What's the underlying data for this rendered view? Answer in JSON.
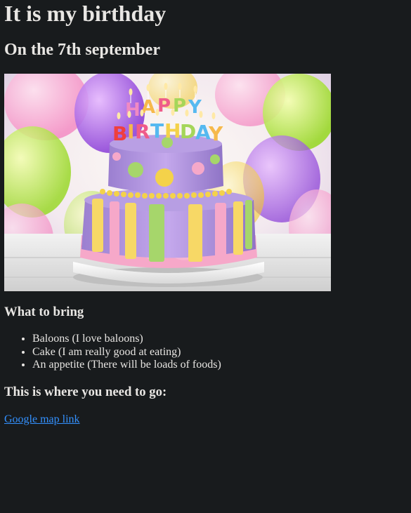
{
  "page": {
    "title": "It is my birthday",
    "subtitle": "On the 7th september",
    "image": {
      "alt": "Birthday cake",
      "cake_topper_text": "HAPPY BIRTHDAY"
    },
    "bring_heading": "What to bring",
    "bring_items": [
      "Baloons (I love baloons)",
      "Cake (I am really good at eating)",
      "An appetite (There will be loads of foods)"
    ],
    "location_heading": "This is where you need to go:",
    "map_link_text": "Google map link"
  },
  "colors": {
    "background": "#181b1d",
    "text": "#e8e6e3",
    "link": "#3391ff"
  }
}
